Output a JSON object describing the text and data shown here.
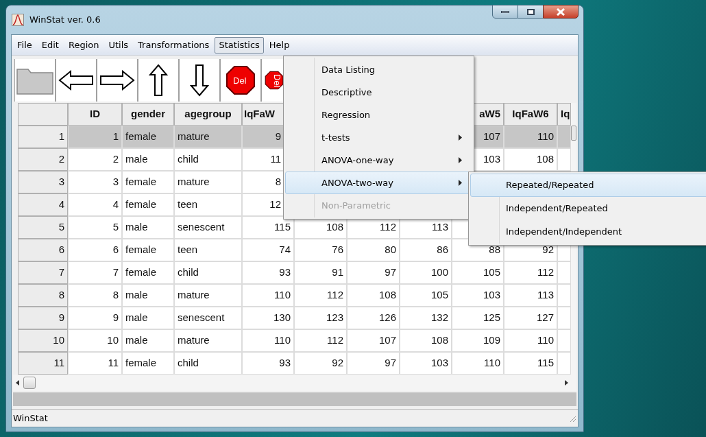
{
  "window": {
    "title": "WinStat ver. 0.6"
  },
  "menu_bar": [
    {
      "label": "File",
      "selected": false
    },
    {
      "label": "Edit",
      "selected": false
    },
    {
      "label": "Region",
      "selected": false
    },
    {
      "label": "Utils",
      "selected": false
    },
    {
      "label": "Transformations",
      "selected": false
    },
    {
      "label": "Statistics",
      "selected": true
    },
    {
      "label": "Help",
      "selected": false
    }
  ],
  "toolbar": [
    {
      "kind": "folder"
    },
    {
      "kind": "arrow-left"
    },
    {
      "kind": "arrow-right"
    },
    {
      "kind": "arrow-up"
    },
    {
      "kind": "arrow-down"
    },
    {
      "kind": "delete",
      "label": "Del"
    },
    {
      "kind": "delete-rotated",
      "label": "Del"
    }
  ],
  "table": {
    "columns": [
      "ID",
      "gender",
      "agegroup",
      "IqFaW",
      null,
      null,
      null,
      "aW5",
      "IqFaW6",
      "Iq"
    ],
    "rows": [
      {
        "header": "1",
        "selected": true,
        "cells": [
          "1",
          "female",
          "mature",
          "9",
          null,
          null,
          null,
          "107",
          "110",
          null
        ]
      },
      {
        "header": "2",
        "selected": false,
        "cells": [
          "2",
          "male",
          "child",
          "11",
          null,
          null,
          null,
          "103",
          "108",
          null
        ]
      },
      {
        "header": "3",
        "selected": false,
        "cells": [
          "3",
          "female",
          "mature",
          "8",
          null,
          null,
          null,
          null,
          null,
          null
        ]
      },
      {
        "header": "4",
        "selected": false,
        "cells": [
          "4",
          "female",
          "teen",
          "12",
          null,
          null,
          null,
          null,
          null,
          null
        ]
      },
      {
        "header": "5",
        "selected": false,
        "cells": [
          "5",
          "male",
          "senescent",
          "115",
          "108",
          "112",
          "113",
          null,
          null,
          null
        ]
      },
      {
        "header": "6",
        "selected": false,
        "cells": [
          "6",
          "female",
          "teen",
          "74",
          "76",
          "80",
          "86",
          "88",
          "92",
          null
        ]
      },
      {
        "header": "7",
        "selected": false,
        "cells": [
          "7",
          "female",
          "child",
          "93",
          "91",
          "97",
          "100",
          "105",
          "112",
          null
        ]
      },
      {
        "header": "8",
        "selected": false,
        "cells": [
          "8",
          "male",
          "mature",
          "110",
          "112",
          "108",
          "105",
          "103",
          "113",
          null
        ]
      },
      {
        "header": "9",
        "selected": false,
        "cells": [
          "9",
          "male",
          "senescent",
          "130",
          "123",
          "126",
          "132",
          "125",
          "127",
          null
        ]
      },
      {
        "header": "10",
        "selected": false,
        "cells": [
          "10",
          "male",
          "mature",
          "110",
          "112",
          "107",
          "108",
          "109",
          "110",
          null
        ]
      },
      {
        "header": "11",
        "selected": false,
        "cells": [
          "11",
          "female",
          "child",
          "93",
          "92",
          "97",
          "103",
          "110",
          "115",
          null
        ]
      }
    ]
  },
  "statistics_menu": [
    {
      "label": "Data Listing",
      "submenu": false,
      "disabled": false,
      "selected": false
    },
    {
      "label": "Descriptive",
      "submenu": false,
      "disabled": false,
      "selected": false
    },
    {
      "label": "Regression",
      "submenu": false,
      "disabled": false,
      "selected": false
    },
    {
      "label": "t-tests",
      "submenu": true,
      "disabled": false,
      "selected": false
    },
    {
      "label": "ANOVA-one-way",
      "submenu": true,
      "disabled": false,
      "selected": false
    },
    {
      "label": "ANOVA-two-way",
      "submenu": true,
      "disabled": false,
      "selected": true
    },
    {
      "label": "Non-Parametric",
      "submenu": false,
      "disabled": true,
      "selected": false
    }
  ],
  "anova_two_way_submenu": [
    {
      "label": "Repeated/Repeated",
      "selected": true
    },
    {
      "label": "Independent/Repeated",
      "selected": false
    },
    {
      "label": "Independent/Independent",
      "selected": false
    }
  ],
  "status_bar": {
    "text": "WinStat"
  }
}
